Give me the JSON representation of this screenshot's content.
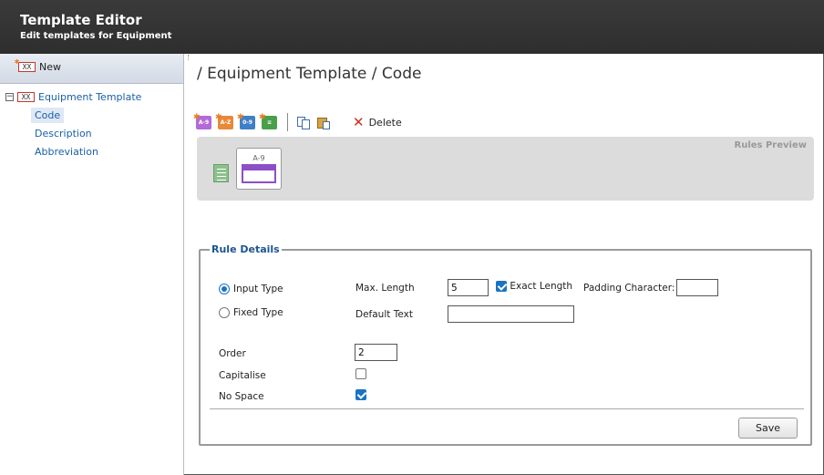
{
  "header": {
    "title": "Template Editor",
    "subtitle": "Edit templates for Equipment"
  },
  "sidebar": {
    "new_label": "New",
    "new_icon_text": "XX",
    "tree": {
      "root_icon_text": "XX",
      "toggle": "−",
      "root_label": "Equipment Template",
      "children": [
        "Code",
        "Description",
        "Abbreviation"
      ],
      "selected": "Code"
    }
  },
  "main": {
    "breadcrumb": "/ Equipment Template / Code",
    "toolbar": {
      "icons": [
        {
          "name": "add-numeric-rule-icon",
          "text": "A-9",
          "color": "#b36ad6"
        },
        {
          "name": "add-alpha-rule-icon",
          "text": "A-Z",
          "color": "#e8893a"
        },
        {
          "name": "add-digit-rule-icon",
          "text": "0-9",
          "color": "#3f7fc8"
        },
        {
          "name": "add-list-rule-icon",
          "text": "",
          "color": "#4aa04a"
        }
      ],
      "delete_label": "Delete"
    },
    "preview": {
      "title": "Rules Preview",
      "tile_label": "A-9"
    },
    "details": {
      "legend": "Rule Details",
      "input_type_label": "Input Type",
      "fixed_type_label": "Fixed Type",
      "max_length_label": "Max. Length",
      "max_length_value": "5",
      "exact_length_label": "Exact Length",
      "padding_label": "Padding Character:",
      "padding_value": "",
      "default_text_label": "Default Text",
      "default_text_value": "",
      "order_label": "Order",
      "order_value": "2",
      "capitalise_label": "Capitalise",
      "nospace_label": "No Space",
      "save_label": "Save",
      "input_type_selected": true,
      "exact_length_checked": true,
      "capitalise_checked": false,
      "nospace_checked": true
    }
  }
}
